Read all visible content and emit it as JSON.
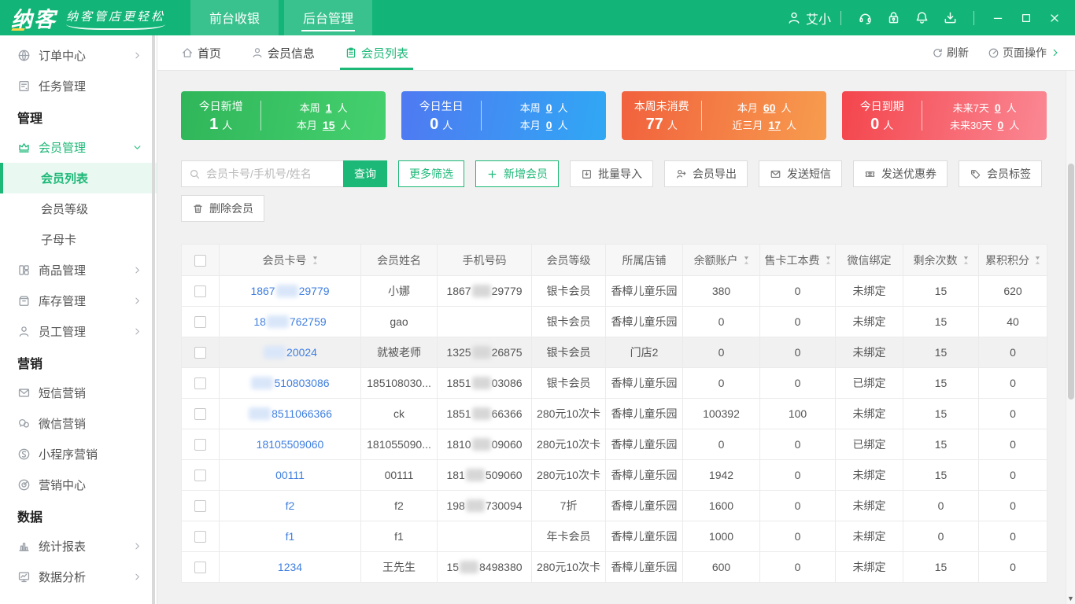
{
  "theme": {
    "accent": "#1cb877",
    "header_green": "#12b577",
    "link_blue": "#3e7edf"
  },
  "titlebar": {
    "logo": "纳客",
    "slogan": "纳客管店更轻松",
    "tabs": [
      {
        "label": "前台收银",
        "active": false
      },
      {
        "label": "后台管理",
        "active": true
      }
    ],
    "user": "艾小",
    "icons": [
      "headset",
      "lock",
      "bell",
      "download"
    ],
    "window_buttons": [
      "minimize",
      "maximize",
      "close"
    ]
  },
  "sidebar": {
    "items": [
      {
        "type": "item",
        "icon": "globe",
        "label": "订单中心",
        "chevron": "right"
      },
      {
        "type": "item",
        "icon": "task",
        "label": "任务管理"
      },
      {
        "type": "section",
        "label": "管理"
      },
      {
        "type": "item",
        "icon": "crown",
        "label": "会员管理",
        "chevron": "down",
        "active": true
      },
      {
        "type": "sub",
        "label": "会员列表",
        "selected": true
      },
      {
        "type": "sub",
        "label": "会员等级"
      },
      {
        "type": "sub",
        "label": "子母卡"
      },
      {
        "type": "item",
        "icon": "goods",
        "label": "商品管理",
        "chevron": "right"
      },
      {
        "type": "item",
        "icon": "inventory",
        "label": "库存管理",
        "chevron": "right"
      },
      {
        "type": "item",
        "icon": "staff",
        "label": "员工管理",
        "chevron": "right"
      },
      {
        "type": "section",
        "label": "营销"
      },
      {
        "type": "item",
        "icon": "sms",
        "label": "短信营销"
      },
      {
        "type": "item",
        "icon": "wechat",
        "label": "微信营销"
      },
      {
        "type": "item",
        "icon": "miniprogram",
        "label": "小程序营销"
      },
      {
        "type": "item",
        "icon": "target",
        "label": "营销中心"
      },
      {
        "type": "section",
        "label": "数据"
      },
      {
        "type": "item",
        "icon": "report",
        "label": "统计报表",
        "chevron": "right"
      },
      {
        "type": "item",
        "icon": "analysis",
        "label": "数据分析",
        "chevron": "right"
      }
    ]
  },
  "page_tabs": {
    "tabs": [
      {
        "icon": "home",
        "label": "首页",
        "active": false
      },
      {
        "icon": "user2",
        "label": "会员信息",
        "active": false
      },
      {
        "icon": "clipboard",
        "label": "会员列表",
        "active": true
      }
    ],
    "actions": [
      {
        "icon": "refresh",
        "label": "刷新",
        "chevron": false
      },
      {
        "icon": "pageops",
        "label": "页面操作",
        "chevron": true
      }
    ]
  },
  "stat_cards": [
    {
      "theme": "green",
      "colors": [
        "#2fb65a",
        "#45d06e"
      ],
      "main_label": "今日新增",
      "main_value": "1",
      "unit": "人",
      "rows": [
        {
          "label": "本周",
          "value": "1"
        },
        {
          "label": "本月",
          "value": "15"
        }
      ]
    },
    {
      "theme": "blue",
      "colors": [
        "#4f79f2",
        "#30a8f4"
      ],
      "main_label": "今日生日",
      "main_value": "0",
      "unit": "人",
      "rows": [
        {
          "label": "本周",
          "value": "0"
        },
        {
          "label": "本月",
          "value": "0"
        }
      ]
    },
    {
      "theme": "orange",
      "colors": [
        "#f1613d",
        "#f79c4e"
      ],
      "main_label": "本周未消费",
      "main_value": "77",
      "unit": "人",
      "rows": [
        {
          "label": "本月",
          "value": "60"
        },
        {
          "label": "近三月",
          "value": "17"
        }
      ]
    },
    {
      "theme": "red",
      "colors": [
        "#f4454c",
        "#fa8894"
      ],
      "main_label": "今日到期",
      "main_value": "0",
      "unit": "人",
      "rows": [
        {
          "label": "未来7天",
          "value": "0"
        },
        {
          "label": "未来30天",
          "value": "0"
        }
      ]
    }
  ],
  "toolbar": {
    "search_placeholder": "会员卡号/手机号/姓名",
    "search_button": "查询",
    "buttons": [
      {
        "label": "更多筛选",
        "style": "outline"
      },
      {
        "label": "新增会员",
        "style": "outline",
        "icon": "plus"
      },
      {
        "label": "批量导入",
        "style": "plain",
        "icon": "import"
      },
      {
        "label": "会员导出",
        "style": "plain",
        "icon": "export"
      },
      {
        "label": "发送短信",
        "style": "plain",
        "icon": "mail"
      },
      {
        "label": "发送优惠券",
        "style": "plain",
        "icon": "coupon"
      },
      {
        "label": "会员标签",
        "style": "plain",
        "icon": "tag"
      }
    ],
    "delete_button": {
      "label": "删除会员",
      "icon": "trash"
    }
  },
  "table": {
    "columns": [
      {
        "label": "会员卡号",
        "sortable": true
      },
      {
        "label": "会员姓名",
        "sortable": false
      },
      {
        "label": "手机号码",
        "sortable": false
      },
      {
        "label": "会员等级",
        "sortable": false
      },
      {
        "label": "所属店铺",
        "sortable": false
      },
      {
        "label": "余额账户",
        "sortable": true
      },
      {
        "label": "售卡工本费",
        "sortable": true
      },
      {
        "label": "微信绑定",
        "sortable": false
      },
      {
        "label": "剩余次数",
        "sortable": true
      },
      {
        "label": "累积积分",
        "sortable": true
      }
    ],
    "rows": [
      {
        "card_pre": "1867",
        "card_redact": true,
        "card_post": "29779",
        "name": "小娜",
        "phone_pre": "1867",
        "phone_redact": true,
        "phone_post": "29779",
        "level": "银卡会员",
        "store": "香樟儿童乐园",
        "balance": "380",
        "fee": "0",
        "wechat": "未绑定",
        "remaining": "15",
        "points": "620"
      },
      {
        "card_pre": "18",
        "card_redact": true,
        "card_post": "762759",
        "name": "gao",
        "phone_pre": "",
        "phone_redact": false,
        "phone_post": "",
        "level": "银卡会员",
        "store": "香樟儿童乐园",
        "balance": "0",
        "fee": "0",
        "wechat": "未绑定",
        "remaining": "15",
        "points": "40"
      },
      {
        "card_pre": "",
        "card_redact": true,
        "card_post": "20024",
        "name": "就被老师",
        "phone_pre": "1325",
        "phone_redact": true,
        "phone_post": "26875",
        "level": "银卡会员",
        "store": "门店2",
        "balance": "0",
        "fee": "0",
        "wechat": "未绑定",
        "remaining": "15",
        "points": "0",
        "highlight": true
      },
      {
        "card_pre": "",
        "card_redact": true,
        "card_post": "510803086",
        "name": "185108030...",
        "phone_pre": "1851",
        "phone_redact": true,
        "phone_post": "03086",
        "level": "银卡会员",
        "store": "香樟儿童乐园",
        "balance": "0",
        "fee": "0",
        "wechat": "已绑定",
        "remaining": "15",
        "points": "0"
      },
      {
        "card_pre": "",
        "card_redact": true,
        "card_post": "8511066366",
        "name": "ck",
        "phone_pre": "1851",
        "phone_redact": true,
        "phone_post": "66366",
        "level": "280元10次卡",
        "store": "香樟儿童乐园",
        "balance": "100392",
        "fee": "100",
        "wechat": "未绑定",
        "remaining": "15",
        "points": "0"
      },
      {
        "card_pre": "18105509060",
        "card_redact": false,
        "card_post": "",
        "name": "181055090...",
        "phone_pre": "1810",
        "phone_redact": true,
        "phone_post": "09060",
        "level": "280元10次卡",
        "store": "香樟儿童乐园",
        "balance": "0",
        "fee": "0",
        "wechat": "已绑定",
        "remaining": "15",
        "points": "0"
      },
      {
        "card_pre": "00111",
        "card_redact": false,
        "card_post": "",
        "name": "00111",
        "phone_pre": "181",
        "phone_redact": true,
        "phone_post": "509060",
        "level": "280元10次卡",
        "store": "香樟儿童乐园",
        "balance": "1942",
        "fee": "0",
        "wechat": "未绑定",
        "remaining": "15",
        "points": "0"
      },
      {
        "card_pre": "f2",
        "card_redact": false,
        "card_post": "",
        "name": "f2",
        "phone_pre": "198",
        "phone_redact": true,
        "phone_post": "730094",
        "level": "7折",
        "store": "香樟儿童乐园",
        "balance": "1600",
        "fee": "0",
        "wechat": "未绑定",
        "remaining": "0",
        "points": "0"
      },
      {
        "card_pre": "f1",
        "card_redact": false,
        "card_post": "",
        "name": "f1",
        "phone_pre": "",
        "phone_redact": false,
        "phone_post": "",
        "level": "年卡会员",
        "store": "香樟儿童乐园",
        "balance": "1000",
        "fee": "0",
        "wechat": "未绑定",
        "remaining": "0",
        "points": "0"
      },
      {
        "card_pre": "1234",
        "card_redact": false,
        "card_post": "",
        "name": "王先生",
        "phone_pre": "15",
        "phone_redact": true,
        "phone_post": "8498380",
        "level": "280元10次卡",
        "store": "香樟儿童乐园",
        "balance": "600",
        "fee": "0",
        "wechat": "未绑定",
        "remaining": "15",
        "points": "0"
      }
    ]
  }
}
